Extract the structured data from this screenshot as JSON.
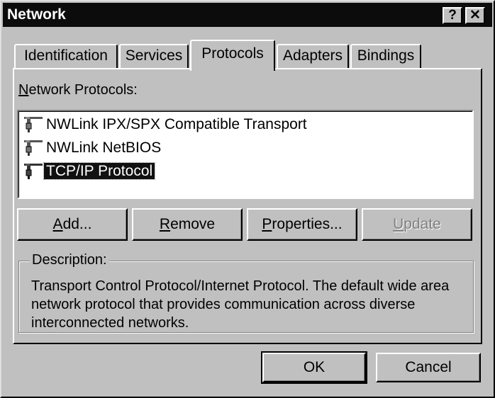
{
  "window": {
    "title": "Network",
    "help_button": "?",
    "close_button": "✕"
  },
  "tabs": [
    {
      "label": "Identification",
      "active": false
    },
    {
      "label": "Services",
      "active": false
    },
    {
      "label": "Protocols",
      "active": true
    },
    {
      "label": "Adapters",
      "active": false
    },
    {
      "label": "Bindings",
      "active": false
    }
  ],
  "protocols": {
    "label_mnemonic": "N",
    "label_rest": "etwork Protocols:",
    "items": [
      {
        "label": "NWLink IPX/SPX Compatible Transport",
        "icon": "network-protocol-icon",
        "selected": false
      },
      {
        "label": "NWLink NetBIOS",
        "icon": "network-protocol-icon",
        "selected": false
      },
      {
        "label": "TCP/IP Protocol",
        "icon": "network-protocol-icon",
        "selected": true
      }
    ]
  },
  "buttons": {
    "add": {
      "mnemonic": "A",
      "rest": "dd..."
    },
    "remove": {
      "mnemonic": "R",
      "rest": "emove"
    },
    "properties": {
      "mnemonic": "P",
      "rest": "roperties..."
    },
    "update": {
      "mnemonic": "U",
      "rest": "pdate",
      "disabled": true
    }
  },
  "description": {
    "label": "Description:",
    "text": "Transport Control Protocol/Internet Protocol. The default wide area network protocol that provides communication across diverse interconnected networks."
  },
  "footer": {
    "ok": "OK",
    "cancel": "Cancel"
  }
}
